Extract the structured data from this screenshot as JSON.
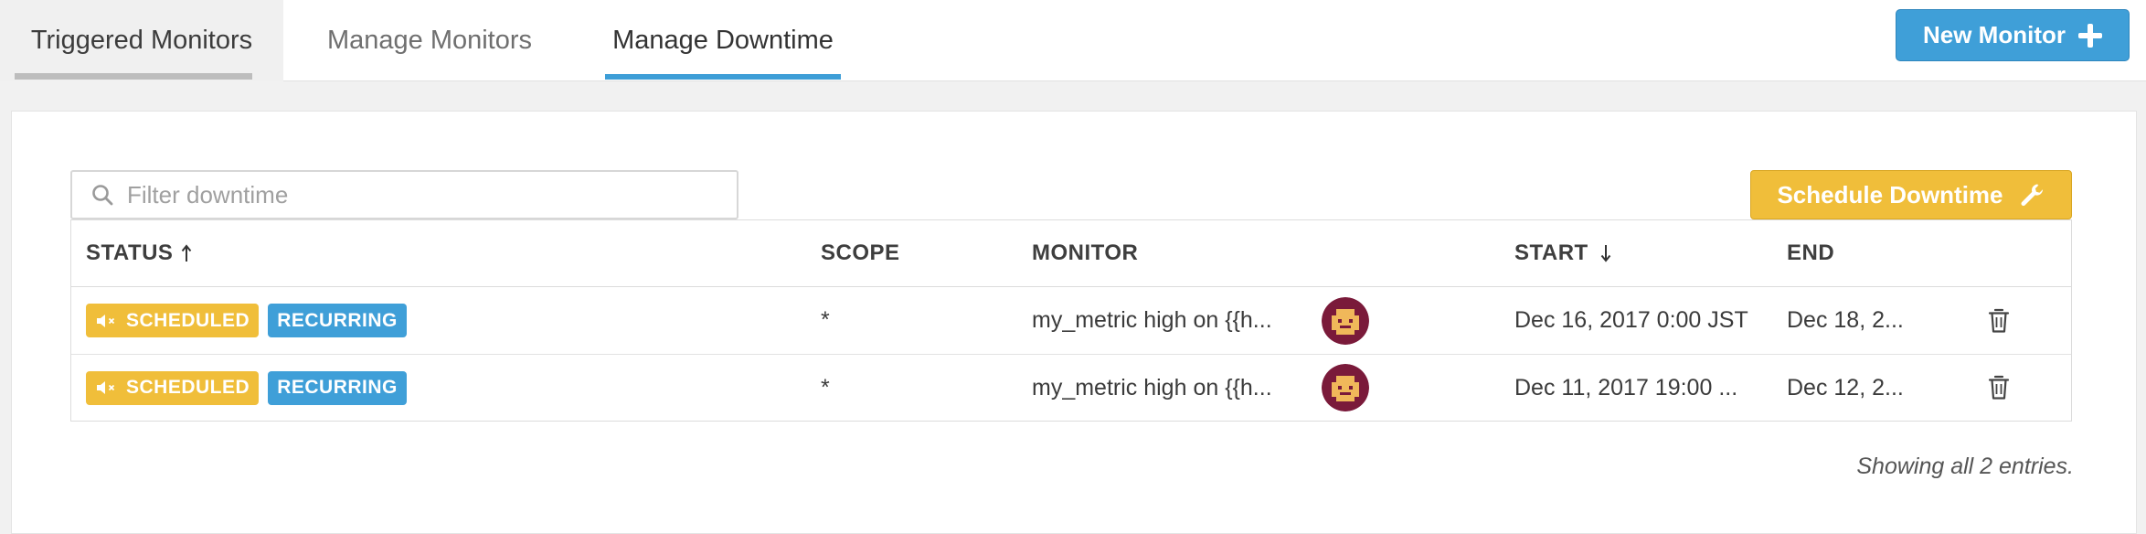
{
  "tabs": {
    "triggered": "Triggered Monitors",
    "manage_monitors": "Manage Monitors",
    "manage_downtime": "Manage Downtime"
  },
  "header": {
    "new_monitor_label": "New Monitor",
    "new_monitor_icon": "plus-icon"
  },
  "filter": {
    "placeholder": "Filter downtime",
    "value": ""
  },
  "schedule_button": {
    "label": "Schedule Downtime",
    "icon": "wrench-icon"
  },
  "table": {
    "headers": {
      "status": "STATUS",
      "scope": "SCOPE",
      "monitor": "MONITOR",
      "start": "START",
      "end": "END"
    },
    "rows": [
      {
        "status": "SCHEDULED",
        "recurrence": "RECURRING",
        "scope": "*",
        "monitor": "my_metric high on {{h...",
        "start": "Dec 16, 2017 0:00 JST",
        "end": "Dec 18, 2..."
      },
      {
        "status": "SCHEDULED",
        "recurrence": "RECURRING",
        "scope": "*",
        "monitor": "my_metric high on {{h...",
        "start": "Dec 11, 2017 19:00 ...",
        "end": "Dec 12, 2..."
      }
    ]
  },
  "footer": {
    "entries_text": "Showing all 2 entries."
  },
  "colors": {
    "accent_blue": "#3f9fd8",
    "accent_yellow": "#f0be3a",
    "avatar_bg": "#7a1a3a",
    "avatar_face": "#f0b85a"
  }
}
